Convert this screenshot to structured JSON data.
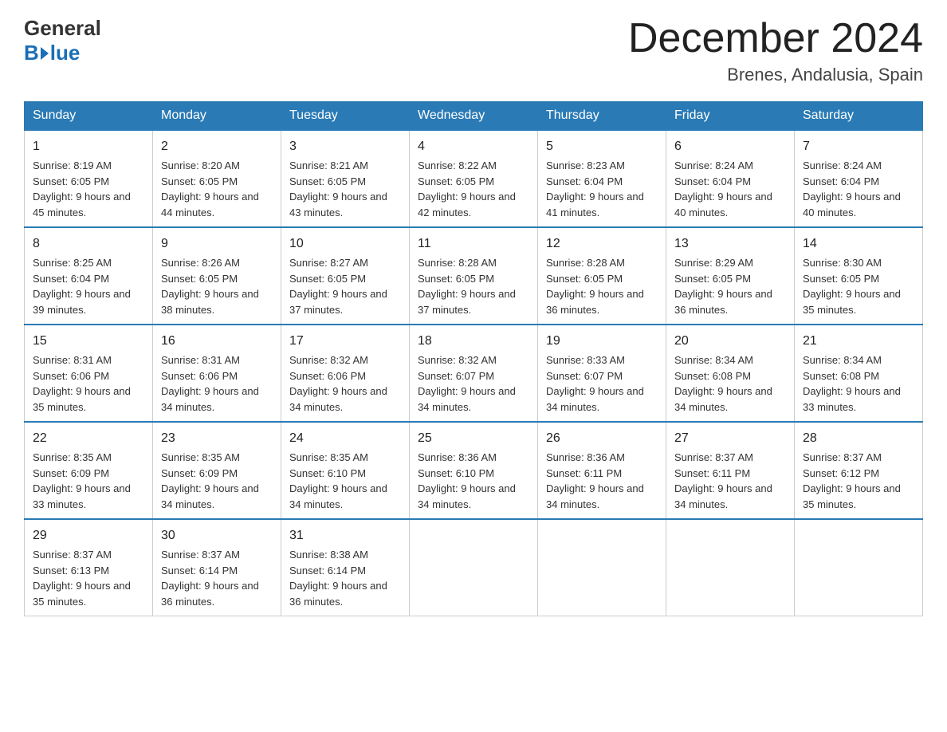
{
  "logo": {
    "general": "General",
    "blue": "Blue"
  },
  "title": "December 2024",
  "location": "Brenes, Andalusia, Spain",
  "headers": [
    "Sunday",
    "Monday",
    "Tuesday",
    "Wednesday",
    "Thursday",
    "Friday",
    "Saturday"
  ],
  "weeks": [
    [
      {
        "day": "1",
        "sunrise": "8:19 AM",
        "sunset": "6:05 PM",
        "daylight": "9 hours and 45 minutes."
      },
      {
        "day": "2",
        "sunrise": "8:20 AM",
        "sunset": "6:05 PM",
        "daylight": "9 hours and 44 minutes."
      },
      {
        "day": "3",
        "sunrise": "8:21 AM",
        "sunset": "6:05 PM",
        "daylight": "9 hours and 43 minutes."
      },
      {
        "day": "4",
        "sunrise": "8:22 AM",
        "sunset": "6:05 PM",
        "daylight": "9 hours and 42 minutes."
      },
      {
        "day": "5",
        "sunrise": "8:23 AM",
        "sunset": "6:04 PM",
        "daylight": "9 hours and 41 minutes."
      },
      {
        "day": "6",
        "sunrise": "8:24 AM",
        "sunset": "6:04 PM",
        "daylight": "9 hours and 40 minutes."
      },
      {
        "day": "7",
        "sunrise": "8:24 AM",
        "sunset": "6:04 PM",
        "daylight": "9 hours and 40 minutes."
      }
    ],
    [
      {
        "day": "8",
        "sunrise": "8:25 AM",
        "sunset": "6:04 PM",
        "daylight": "9 hours and 39 minutes."
      },
      {
        "day": "9",
        "sunrise": "8:26 AM",
        "sunset": "6:05 PM",
        "daylight": "9 hours and 38 minutes."
      },
      {
        "day": "10",
        "sunrise": "8:27 AM",
        "sunset": "6:05 PM",
        "daylight": "9 hours and 37 minutes."
      },
      {
        "day": "11",
        "sunrise": "8:28 AM",
        "sunset": "6:05 PM",
        "daylight": "9 hours and 37 minutes."
      },
      {
        "day": "12",
        "sunrise": "8:28 AM",
        "sunset": "6:05 PM",
        "daylight": "9 hours and 36 minutes."
      },
      {
        "day": "13",
        "sunrise": "8:29 AM",
        "sunset": "6:05 PM",
        "daylight": "9 hours and 36 minutes."
      },
      {
        "day": "14",
        "sunrise": "8:30 AM",
        "sunset": "6:05 PM",
        "daylight": "9 hours and 35 minutes."
      }
    ],
    [
      {
        "day": "15",
        "sunrise": "8:31 AM",
        "sunset": "6:06 PM",
        "daylight": "9 hours and 35 minutes."
      },
      {
        "day": "16",
        "sunrise": "8:31 AM",
        "sunset": "6:06 PM",
        "daylight": "9 hours and 34 minutes."
      },
      {
        "day": "17",
        "sunrise": "8:32 AM",
        "sunset": "6:06 PM",
        "daylight": "9 hours and 34 minutes."
      },
      {
        "day": "18",
        "sunrise": "8:32 AM",
        "sunset": "6:07 PM",
        "daylight": "9 hours and 34 minutes."
      },
      {
        "day": "19",
        "sunrise": "8:33 AM",
        "sunset": "6:07 PM",
        "daylight": "9 hours and 34 minutes."
      },
      {
        "day": "20",
        "sunrise": "8:34 AM",
        "sunset": "6:08 PM",
        "daylight": "9 hours and 34 minutes."
      },
      {
        "day": "21",
        "sunrise": "8:34 AM",
        "sunset": "6:08 PM",
        "daylight": "9 hours and 33 minutes."
      }
    ],
    [
      {
        "day": "22",
        "sunrise": "8:35 AM",
        "sunset": "6:09 PM",
        "daylight": "9 hours and 33 minutes."
      },
      {
        "day": "23",
        "sunrise": "8:35 AM",
        "sunset": "6:09 PM",
        "daylight": "9 hours and 34 minutes."
      },
      {
        "day": "24",
        "sunrise": "8:35 AM",
        "sunset": "6:10 PM",
        "daylight": "9 hours and 34 minutes."
      },
      {
        "day": "25",
        "sunrise": "8:36 AM",
        "sunset": "6:10 PM",
        "daylight": "9 hours and 34 minutes."
      },
      {
        "day": "26",
        "sunrise": "8:36 AM",
        "sunset": "6:11 PM",
        "daylight": "9 hours and 34 minutes."
      },
      {
        "day": "27",
        "sunrise": "8:37 AM",
        "sunset": "6:11 PM",
        "daylight": "9 hours and 34 minutes."
      },
      {
        "day": "28",
        "sunrise": "8:37 AM",
        "sunset": "6:12 PM",
        "daylight": "9 hours and 35 minutes."
      }
    ],
    [
      {
        "day": "29",
        "sunrise": "8:37 AM",
        "sunset": "6:13 PM",
        "daylight": "9 hours and 35 minutes."
      },
      {
        "day": "30",
        "sunrise": "8:37 AM",
        "sunset": "6:14 PM",
        "daylight": "9 hours and 36 minutes."
      },
      {
        "day": "31",
        "sunrise": "8:38 AM",
        "sunset": "6:14 PM",
        "daylight": "9 hours and 36 minutes."
      },
      null,
      null,
      null,
      null
    ]
  ]
}
